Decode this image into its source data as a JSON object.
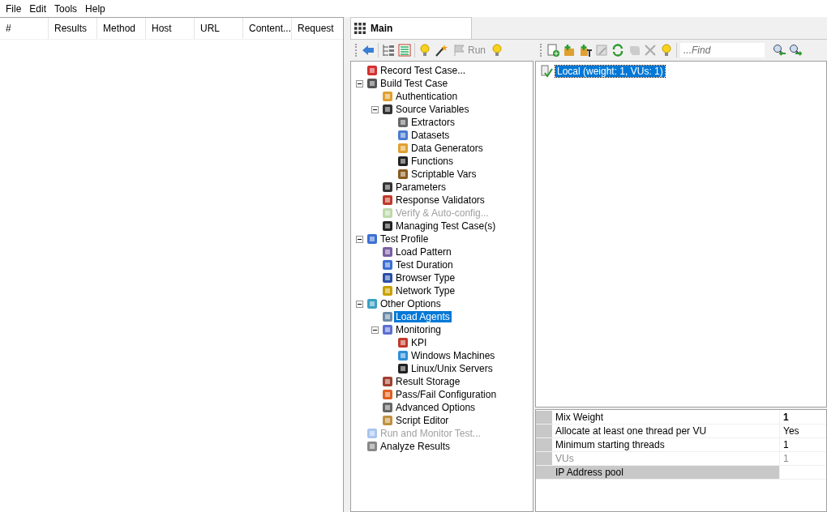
{
  "menu": [
    "File",
    "Edit",
    "Tools",
    "Help"
  ],
  "results_table": {
    "columns": [
      "#",
      "Results",
      "Method",
      "Host",
      "URL",
      "Content...",
      "Request"
    ]
  },
  "tabs": [
    {
      "label": "Main",
      "selected": true
    }
  ],
  "tree_toolbar": {
    "run_button": {
      "label": "Run",
      "disabled": true
    }
  },
  "tree": [
    {
      "label": "Record Test Case...",
      "disabled": false,
      "selected": false
    },
    {
      "label": "Build Test Case",
      "disabled": false,
      "selected": false,
      "expanded": true,
      "children": [
        {
          "label": "Authentication",
          "disabled": false,
          "selected": false
        },
        {
          "label": "Source Variables",
          "disabled": false,
          "selected": false,
          "expanded": true,
          "children": [
            {
              "label": "Extractors",
              "disabled": false,
              "selected": false
            },
            {
              "label": "Datasets",
              "disabled": false,
              "selected": false
            },
            {
              "label": "Data Generators",
              "disabled": false,
              "selected": false
            },
            {
              "label": "Functions",
              "disabled": false,
              "selected": false
            },
            {
              "label": "Scriptable Vars",
              "disabled": false,
              "selected": false
            }
          ]
        },
        {
          "label": "Parameters",
          "disabled": false,
          "selected": false
        },
        {
          "label": "Response Validators",
          "disabled": false,
          "selected": false
        },
        {
          "label": "Verify & Auto-config...",
          "disabled": true,
          "selected": false
        },
        {
          "label": "Managing Test Case(s)",
          "disabled": false,
          "selected": false
        }
      ]
    },
    {
      "label": "Test Profile",
      "disabled": false,
      "selected": false,
      "expanded": true,
      "children": [
        {
          "label": "Load Pattern",
          "disabled": false,
          "selected": false
        },
        {
          "label": "Test Duration",
          "disabled": false,
          "selected": false
        },
        {
          "label": "Browser Type",
          "disabled": false,
          "selected": false
        },
        {
          "label": "Network Type",
          "disabled": false,
          "selected": false
        }
      ]
    },
    {
      "label": "Other Options",
      "disabled": false,
      "selected": false,
      "expanded": true,
      "children": [
        {
          "label": "Load Agents",
          "disabled": false,
          "selected": true
        },
        {
          "label": "Monitoring",
          "disabled": false,
          "selected": false,
          "expanded": true,
          "children": [
            {
              "label": "KPI",
              "disabled": false,
              "selected": false
            },
            {
              "label": "Windows Machines",
              "disabled": false,
              "selected": false
            },
            {
              "label": "Linux/Unix Servers",
              "disabled": false,
              "selected": false
            }
          ]
        },
        {
          "label": "Result Storage",
          "disabled": false,
          "selected": false
        },
        {
          "label": "Pass/Fail Configuration",
          "disabled": false,
          "selected": false
        },
        {
          "label": "Advanced Options",
          "disabled": false,
          "selected": false
        },
        {
          "label": "Script Editor",
          "disabled": false,
          "selected": false
        }
      ]
    },
    {
      "label": "Run and Monitor Test...",
      "disabled": true,
      "selected": false
    },
    {
      "label": "Analyze Results",
      "disabled": false,
      "selected": false
    }
  ],
  "agents_toolbar": {
    "find": {
      "placeholder": "...Find"
    }
  },
  "agents": [
    {
      "label": "Local (weight: 1, VUs: 1)",
      "selected": true
    }
  ],
  "properties": [
    {
      "name": "Mix Weight",
      "value": "1",
      "bold": true,
      "disabled": false,
      "selected": false
    },
    {
      "name": "Allocate at least one thread per VU",
      "value": "Yes",
      "bold": false,
      "disabled": false,
      "selected": false
    },
    {
      "name": "Minimum starting threads",
      "value": "1",
      "bold": false,
      "disabled": false,
      "selected": false
    },
    {
      "name": "VUs",
      "value": "1",
      "bold": false,
      "disabled": true,
      "selected": false
    },
    {
      "name": "IP Address pool",
      "disabled": false,
      "selected": true
    }
  ]
}
